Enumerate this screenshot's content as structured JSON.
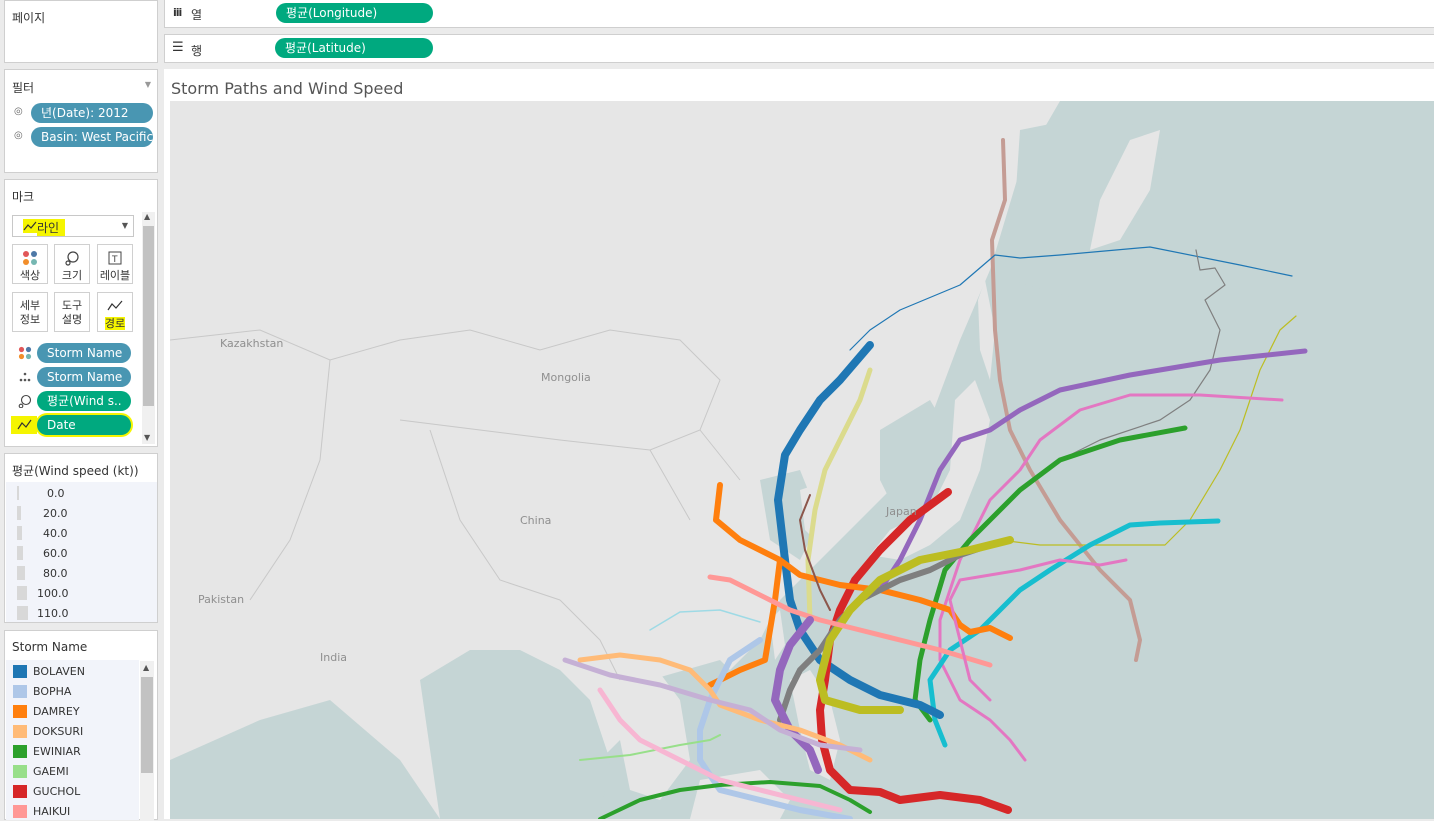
{
  "pages_panel": {
    "title": "페이지"
  },
  "shelves": {
    "columns": {
      "label": "열",
      "pill": "평균(Longitude)"
    },
    "rows": {
      "label": "행",
      "pill": "평균(Latitude)"
    }
  },
  "filters": {
    "title": "필터",
    "items": [
      {
        "label": "년(Date): 2012"
      },
      {
        "label": "Basin: West Pacific"
      }
    ]
  },
  "marks": {
    "title": "마크",
    "mark_type": "라인",
    "buttons": [
      {
        "label": "색상"
      },
      {
        "label": "크기"
      },
      {
        "label": "레이블"
      },
      {
        "label": "세부\n정보"
      },
      {
        "label": "도구\n설명"
      },
      {
        "label": "경로"
      }
    ],
    "fields": [
      {
        "label": "Storm Name"
      },
      {
        "label": "Storm Name"
      },
      {
        "label": "평균(Wind s.."
      },
      {
        "label": "Date"
      }
    ]
  },
  "size_legend": {
    "title": "평균(Wind speed (kt))",
    "values": [
      "0.0",
      "20.0",
      "40.0",
      "60.0",
      "80.0",
      "100.0",
      "110.0"
    ]
  },
  "color_legend": {
    "title": "Storm Name",
    "items": [
      {
        "name": "BOLAVEN",
        "color": "#1f77b4"
      },
      {
        "name": "BOPHA",
        "color": "#aec7e8"
      },
      {
        "name": "DAMREY",
        "color": "#ff7f0e"
      },
      {
        "name": "DOKSURI",
        "color": "#ffbb78"
      },
      {
        "name": "EWINIAR",
        "color": "#2ca02c"
      },
      {
        "name": "GAEMI",
        "color": "#98df8a"
      },
      {
        "name": "GUCHOL",
        "color": "#d62728"
      },
      {
        "name": "HAIKUI",
        "color": "#ff9896"
      }
    ]
  },
  "viz": {
    "title": "Storm Paths and Wind Speed",
    "map_labels": {
      "kazakhstan": "Kazakhstan",
      "mongolia": "Mongolia",
      "china": "China",
      "pakistan": "Pakistan",
      "india": "India",
      "japan": "Japan"
    }
  },
  "colors": {
    "pill_blue": "#4996b2",
    "pill_green": "#00a97f",
    "highlight": "#f5f500",
    "land": "#e6e6e6",
    "water": "#c3d4d4"
  }
}
